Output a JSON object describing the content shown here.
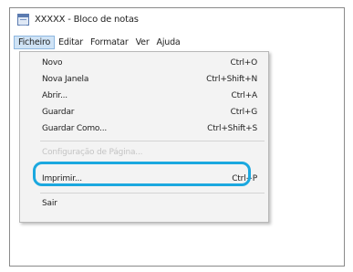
{
  "window": {
    "title": "XXXXX - Bloco de notas",
    "icon": "notepad-icon"
  },
  "menubar": {
    "items": [
      "Ficheiro",
      "Editar",
      "Formatar",
      "Ver",
      "Ajuda"
    ],
    "active": "Ficheiro"
  },
  "menu": {
    "items": [
      {
        "label": "Novo",
        "shortcut": "Ctrl+O"
      },
      {
        "label": "Nova Janela",
        "shortcut": "Ctrl+Shift+N"
      },
      {
        "label": "Abrir...",
        "shortcut": "Ctrl+A"
      },
      {
        "label": "Guardar",
        "shortcut": "Ctrl+G"
      },
      {
        "label": "Guardar Como...",
        "shortcut": "Ctrl+Shift+S"
      },
      {
        "label": "Configuração de Página...",
        "shortcut": ""
      },
      {
        "label": "Imprimir...",
        "shortcut": "Ctrl+P"
      },
      {
        "label": "Sair",
        "shortcut": ""
      }
    ]
  },
  "highlight": {
    "target": "Imprimir...",
    "color": "#1ba8df"
  }
}
